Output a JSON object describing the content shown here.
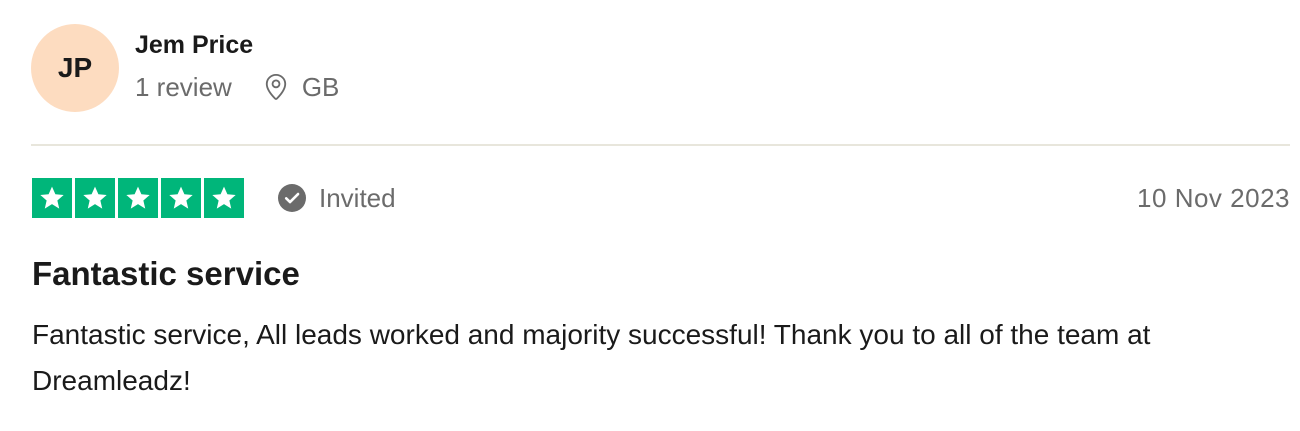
{
  "reviewer": {
    "initials": "JP",
    "name": "Jem Price",
    "review_count": "1 review",
    "country": "GB",
    "avatar_color": "#fddcc0"
  },
  "review": {
    "rating": 5,
    "rating_max": 5,
    "star_color": "#00b67a",
    "badge": "Invited",
    "date": "10 Nov 2023",
    "title": "Fantastic service",
    "body": "Fantastic service, All leads worked and majority successful! Thank you to all of the team at Dreamleadz!"
  },
  "icons": {
    "location": "location-pin-icon",
    "verified": "check-circle-icon",
    "star": "star-icon"
  }
}
